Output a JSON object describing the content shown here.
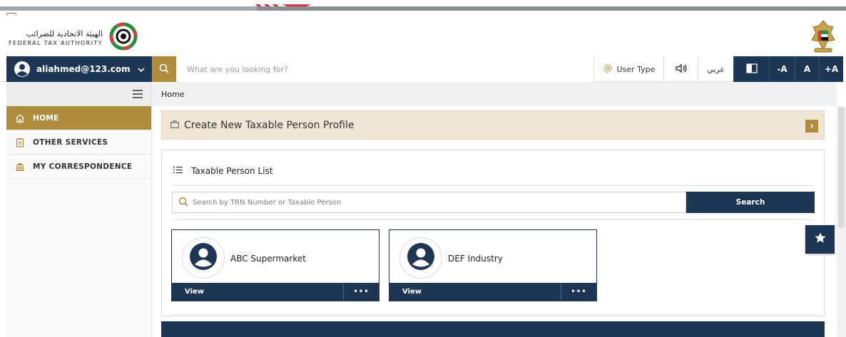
{
  "header": {
    "logo_arabic": "الهيئة الاتحادية للضرائب",
    "logo_english": "FEDERAL TAX AUTHORITY",
    "logo_icon": "fta-logo-icon",
    "emblem_icon": "uae-emblem-icon"
  },
  "topbar": {
    "account_email": "aliahmed@123.com",
    "search_placeholder": "What are you looking for?",
    "user_type_label": "User Type",
    "language_label": "عربي",
    "font_decrease_label": "-A",
    "font_normal_label": "A",
    "font_increase_label": "+A"
  },
  "sidebar": {
    "items": [
      {
        "label": "HOME",
        "icon": "home-icon",
        "active": true
      },
      {
        "label": "OTHER SERVICES",
        "icon": "clipboard-icon",
        "active": false
      },
      {
        "label": "MY CORRESPONDENCE",
        "icon": "bank-icon",
        "active": false
      }
    ]
  },
  "breadcrumb": {
    "current": "Home"
  },
  "main": {
    "create_banner_label": "Create New Taxable Person Profile",
    "list_title": "Taxable Person List",
    "list_search_placeholder": "Search by TRN Number or Taxable Person",
    "list_search_button": "Search",
    "cards": [
      {
        "name": "ABC Supermarket",
        "view_label": "View",
        "more_label": "•••"
      },
      {
        "name": "DEF Industry",
        "view_label": "View",
        "more_label": "•••"
      }
    ]
  },
  "colors": {
    "navy": "#1d3654",
    "gold": "#b08d3c",
    "banner_beige": "#efe6d7"
  }
}
